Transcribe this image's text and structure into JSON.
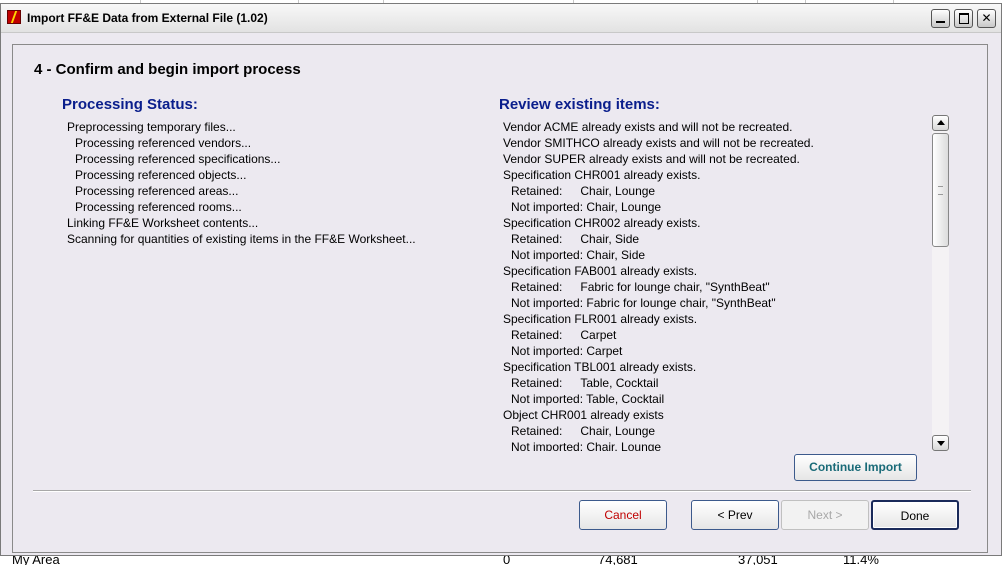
{
  "window": {
    "title": "Import FF&E Data from External File (1.02)"
  },
  "titlebar_buttons": {
    "minimize": "minimize-icon",
    "maximize": "maximize-icon",
    "close": "✕"
  },
  "step": {
    "title": "4 - Confirm and begin import process"
  },
  "processing": {
    "header": "Processing Status:",
    "lines": [
      "Preprocessing temporary files...",
      "Processing referenced vendors...",
      "Processing referenced specifications...",
      "Processing referenced objects...",
      "Processing referenced areas...",
      "Processing referenced rooms...",
      "Linking FF&E Worksheet contents...",
      "Scanning for quantities of existing items in the FF&E Worksheet..."
    ]
  },
  "review": {
    "header": "Review existing items:",
    "lines": [
      "Vendor ACME already exists and will not be recreated.",
      "Vendor SMITHCO already exists and will not be recreated.",
      "Vendor SUPER already exists and will not be recreated.",
      "Specification CHR001 already exists.",
      "Retained:",
      "Chair, Lounge",
      "Not imported: Chair, Lounge",
      "Specification CHR002 already exists.",
      "Retained:",
      "Chair, Side",
      "Not imported: Chair, Side",
      "Specification FAB001 already exists.",
      "Retained:",
      "Fabric for lounge chair, \"SynthBeat\"",
      "Not imported: Fabric for lounge chair, \"SynthBeat\"",
      "Specification FLR001 already exists.",
      "Retained:",
      "Carpet",
      "Not imported: Carpet",
      "Specification TBL001 already exists.",
      "Retained:",
      "Table, Cocktail",
      "Not imported: Table, Cocktail",
      "Object CHR001 already exists",
      "Retained:",
      "Chair, Lounge",
      "Not imported: Chair, Lounge"
    ]
  },
  "buttons": {
    "continue_import": "Continue Import",
    "cancel": "Cancel",
    "prev": "< Prev",
    "next": "Next >",
    "done": "Done"
  },
  "background_row": {
    "name": "My Area",
    "col1": "0",
    "col2": "74,681",
    "col3": "37,051",
    "col4": "11.4%"
  },
  "colors": {
    "header_blue": "#0a1e8c",
    "cancel_red": "#c00000",
    "continue_teal": "#1a6b78",
    "dialog_bg": "#ece9f0"
  }
}
